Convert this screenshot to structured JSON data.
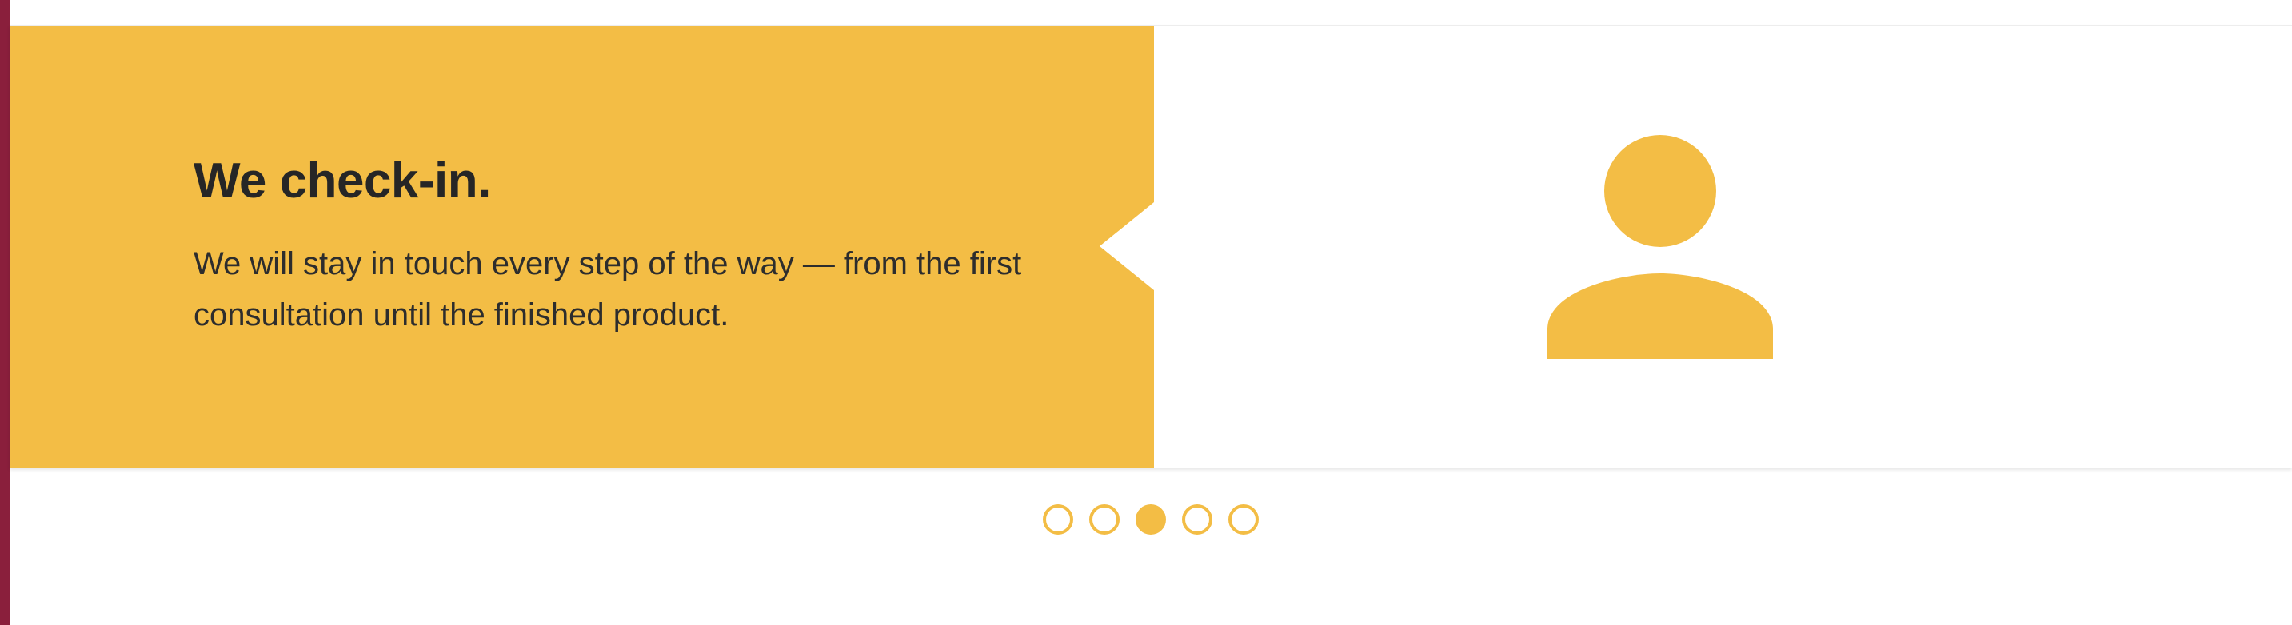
{
  "slide": {
    "title": "We check-in.",
    "body": "We will stay in touch every step of the way — from the first consultation until the finished product.",
    "icon": "person-icon"
  },
  "pagination": {
    "total": 5,
    "active_index": 2
  },
  "colors": {
    "accent": "#f3bd45",
    "text": "#262626",
    "edge": "#8a1f3c"
  }
}
